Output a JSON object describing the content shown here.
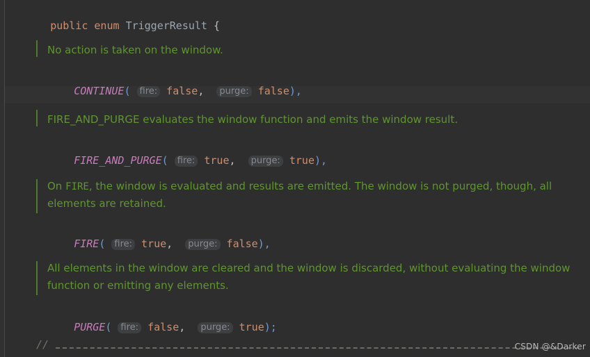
{
  "editor": {
    "background": "#2e2e2e",
    "gutter_color": "#313131",
    "current_line_highlight": "#323232",
    "keyword_color": "#cf8e6d",
    "type_color": "#9aa7b0",
    "enum_constant_color": "#c77dbb",
    "doc_comment_color": "#5f962f",
    "hint_background": "#3d3f41",
    "hint_text_color": "#868a91"
  },
  "code": {
    "declaration": {
      "modifier": "public",
      "keyword": "enum",
      "type_name": "TriggerResult",
      "open_brace": "{"
    },
    "constants": [
      {
        "doc": "No action is taken on the window.",
        "name": "CONTINUE",
        "open_paren": "(",
        "hint_fire": "fire:",
        "fire_value": "false",
        "separator": ",",
        "hint_purge": "purge:",
        "purge_value": "false",
        "close": "),"
      },
      {
        "doc": "FIRE_AND_PURGE evaluates the window function and emits the window result.",
        "name": "FIRE_AND_PURGE",
        "open_paren": "(",
        "hint_fire": "fire:",
        "fire_value": "true",
        "separator": ",",
        "hint_purge": "purge:",
        "purge_value": "true",
        "close": "),"
      },
      {
        "doc_part1": "On ",
        "doc_code": "FIRE",
        "doc_part2": ", the window is evaluated and results are emitted. The window is not purged, though, all",
        "doc_line2": "elements are retained.",
        "name": "FIRE",
        "open_paren": "(",
        "hint_fire": "fire:",
        "fire_value": "true",
        "separator": ",",
        "hint_purge": "purge:",
        "purge_value": "false",
        "close": "),"
      },
      {
        "doc_line1": "All elements in the window are cleared and the window is discarded, without evaluating the window",
        "doc_line2": "function or emitting any elements.",
        "name": "PURGE",
        "open_paren": "(",
        "hint_fire": "fire:",
        "fire_value": "false",
        "separator": ",",
        "hint_purge": "purge:",
        "purge_value": "true",
        "close": ");"
      }
    ],
    "trailing_comment": {
      "slashes": "//",
      "dashes": "-------------------------------------------------------------------------------"
    }
  },
  "watermark": {
    "text": "CSDN @&Darker"
  }
}
